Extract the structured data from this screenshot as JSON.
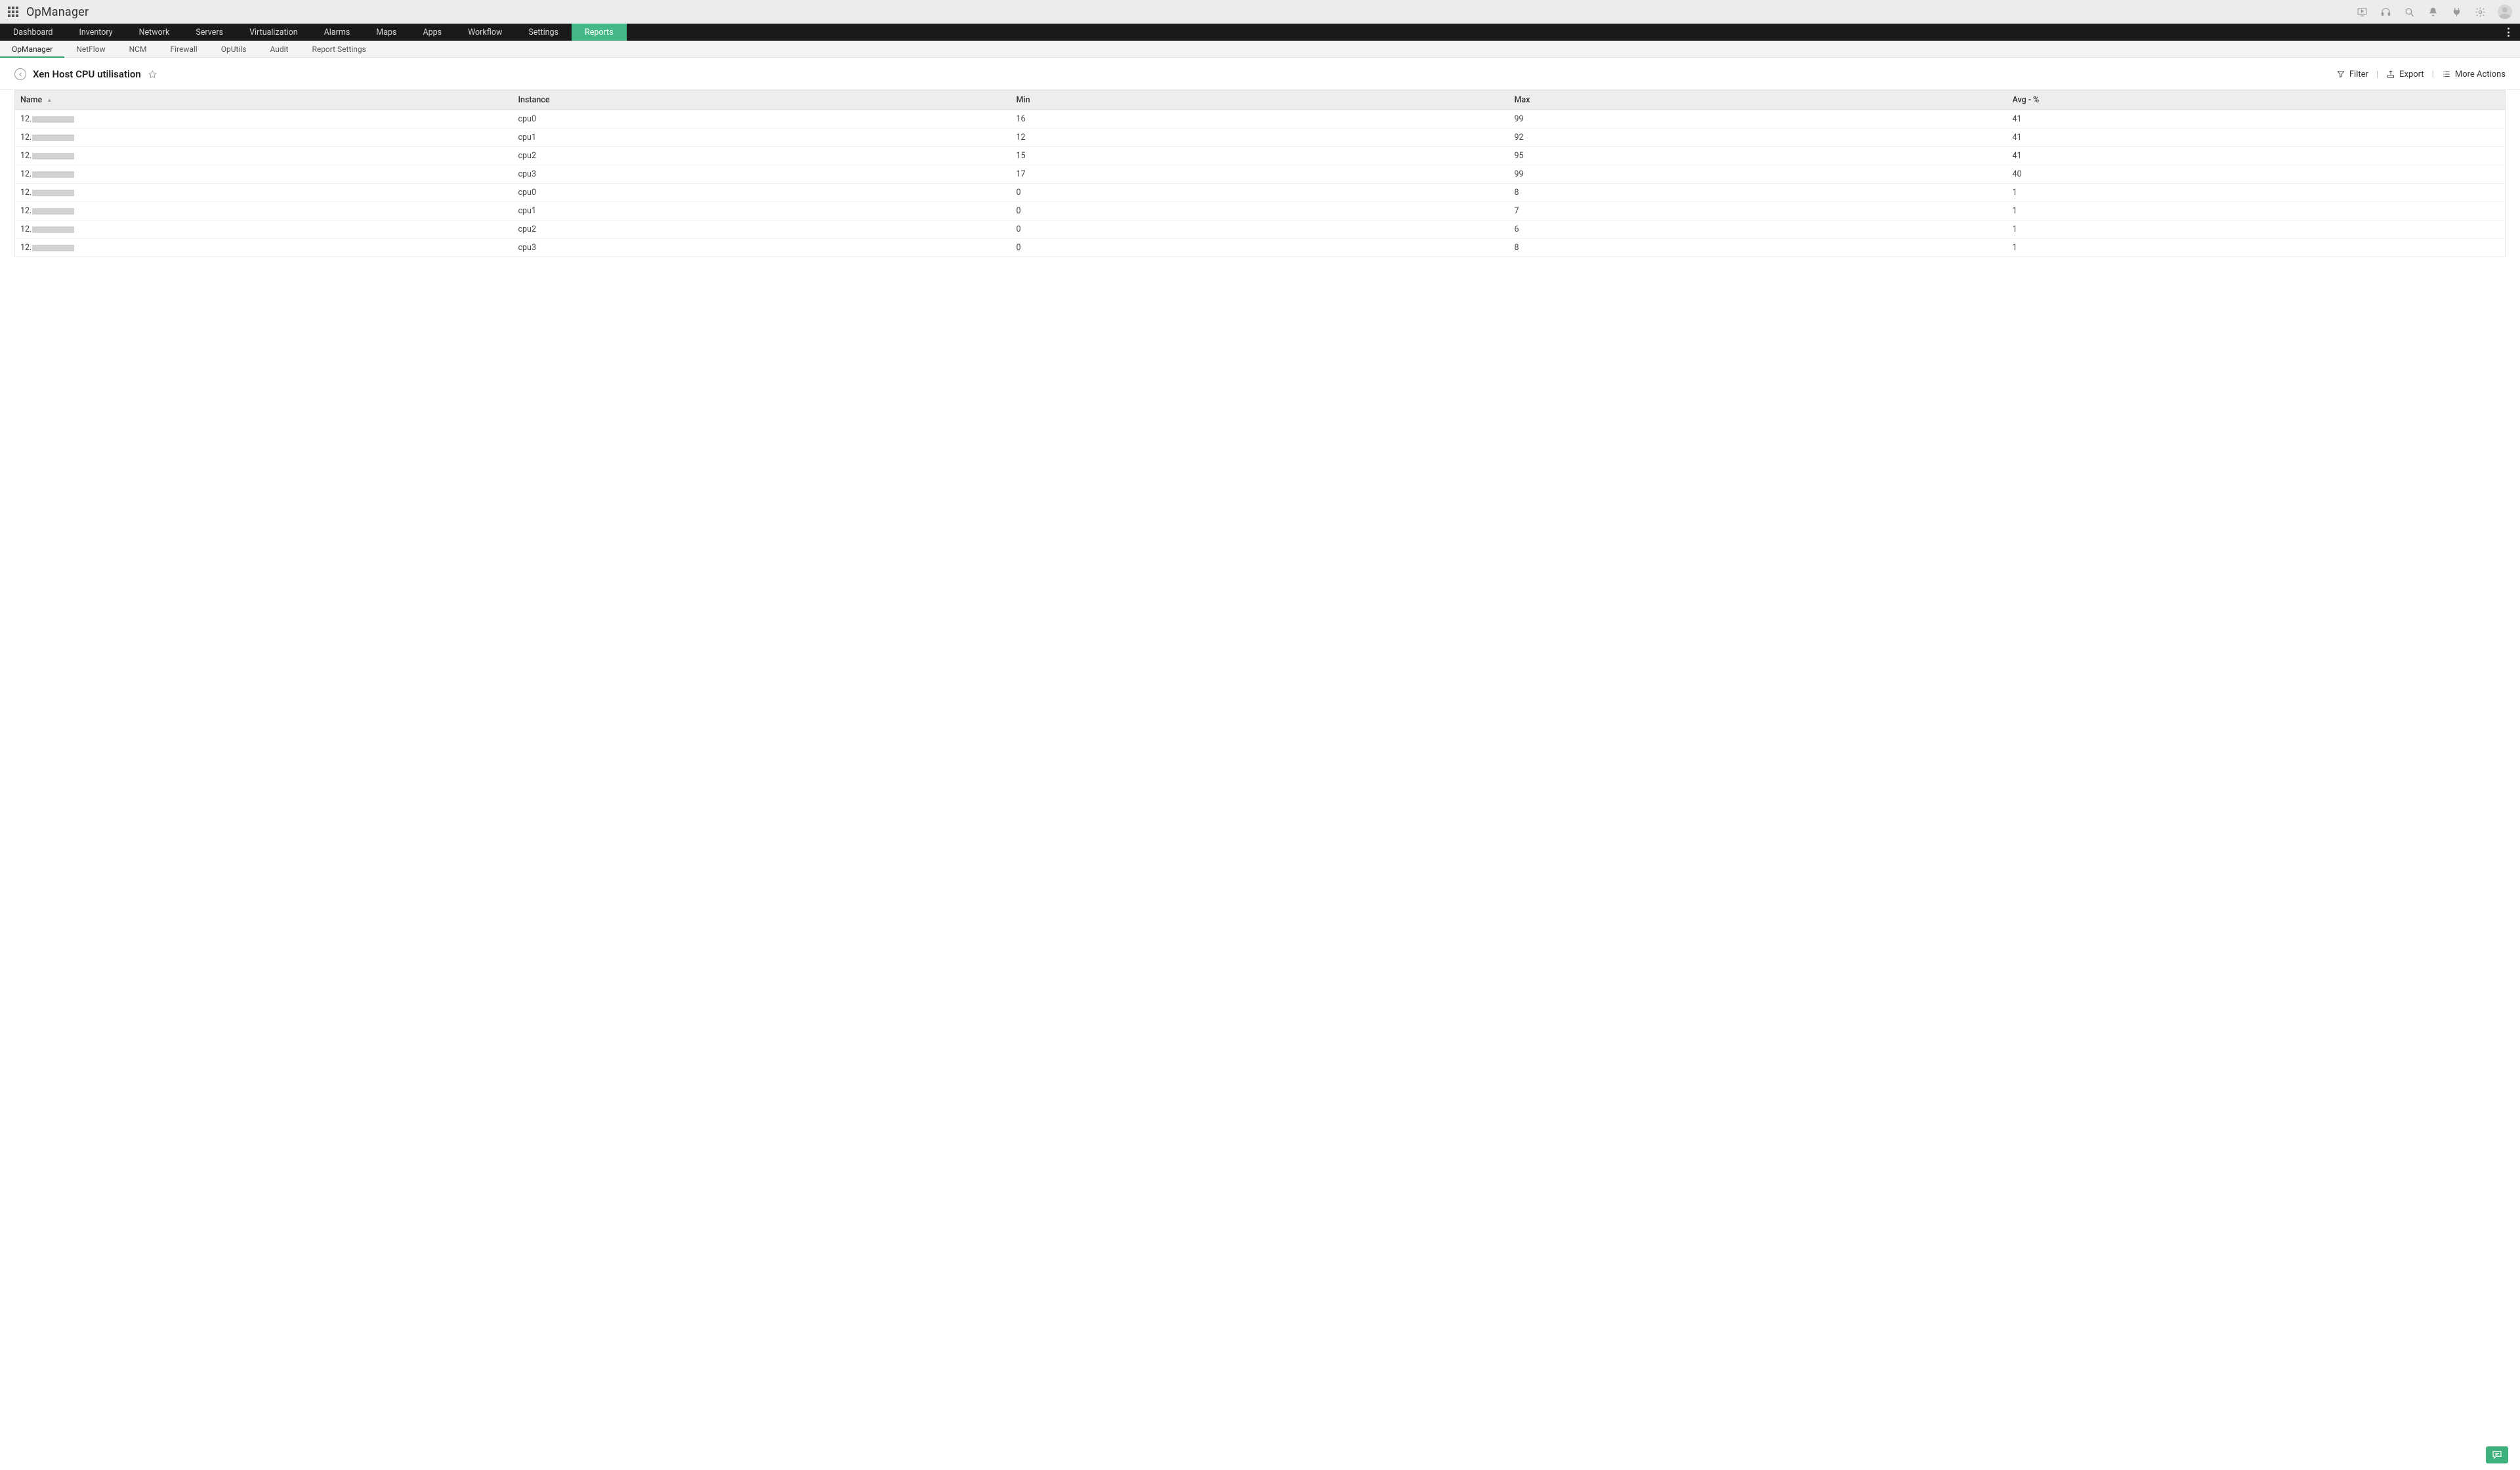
{
  "brand": "OpManager",
  "main_nav": {
    "items": [
      "Dashboard",
      "Inventory",
      "Network",
      "Servers",
      "Virtualization",
      "Alarms",
      "Maps",
      "Apps",
      "Workflow",
      "Settings",
      "Reports"
    ],
    "active_index": 10
  },
  "sub_nav": {
    "items": [
      "OpManager",
      "NetFlow",
      "NCM",
      "Firewall",
      "OpUtils",
      "Audit",
      "Report Settings"
    ],
    "active_index": 0
  },
  "page": {
    "title": "Xen Host CPU utilisation",
    "actions": {
      "filter": "Filter",
      "export": "Export",
      "more": "More Actions"
    }
  },
  "table": {
    "columns": [
      "Name",
      "Instance",
      "Min",
      "Max",
      "Avg - %"
    ],
    "sort_column_index": 0,
    "rows": [
      {
        "name": "12.",
        "instance": "cpu0",
        "min": "16",
        "max": "99",
        "avg": "41"
      },
      {
        "name": "12.",
        "instance": "cpu1",
        "min": "12",
        "max": "92",
        "avg": "41"
      },
      {
        "name": "12.",
        "instance": "cpu2",
        "min": "15",
        "max": "95",
        "avg": "41"
      },
      {
        "name": "12.",
        "instance": "cpu3",
        "min": "17",
        "max": "99",
        "avg": "40"
      },
      {
        "name": "12.",
        "instance": "cpu0",
        "min": "0",
        "max": "8",
        "avg": "1"
      },
      {
        "name": "12.",
        "instance": "cpu1",
        "min": "0",
        "max": "7",
        "avg": "1"
      },
      {
        "name": "12.",
        "instance": "cpu2",
        "min": "0",
        "max": "6",
        "avg": "1"
      },
      {
        "name": "12.",
        "instance": "cpu3",
        "min": "0",
        "max": "8",
        "avg": "1"
      }
    ]
  }
}
